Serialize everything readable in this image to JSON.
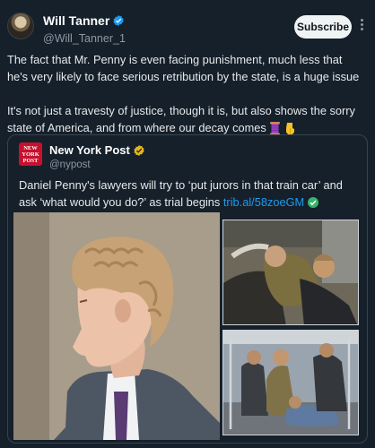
{
  "author": {
    "display_name": "Will Tanner",
    "handle": "@Will_Tanner_1",
    "subscribe_label": "Subscribe"
  },
  "tweet": {
    "paragraph1": "The fact that Mr. Penny is even facing punishment, much less that he's very likely to face serious retribution by the state, is a huge issue",
    "paragraph2": "It's not just a travesty of justice, though it is, but also shows the sorry state of America, and from where our decay comes",
    "emojis": [
      "thread-spool-emoji",
      "pointing-down-emoji"
    ]
  },
  "quoted": {
    "display_name": "New York Post",
    "handle": "@nypost",
    "avatar_text": [
      "NEW",
      "YORK",
      "POST"
    ],
    "text": "Daniel Penny's lawyers will try to ‘put jurors in that train car’ and ask ‘what would you do?’ as trial begins ",
    "link": "trib.al/58zoeGM"
  },
  "colors": {
    "background": "#15202b",
    "link": "#1d9bf0",
    "verified_blue": "#1d9bf0",
    "verified_gold": "#e2b719",
    "nypost_red": "#c8102e"
  }
}
